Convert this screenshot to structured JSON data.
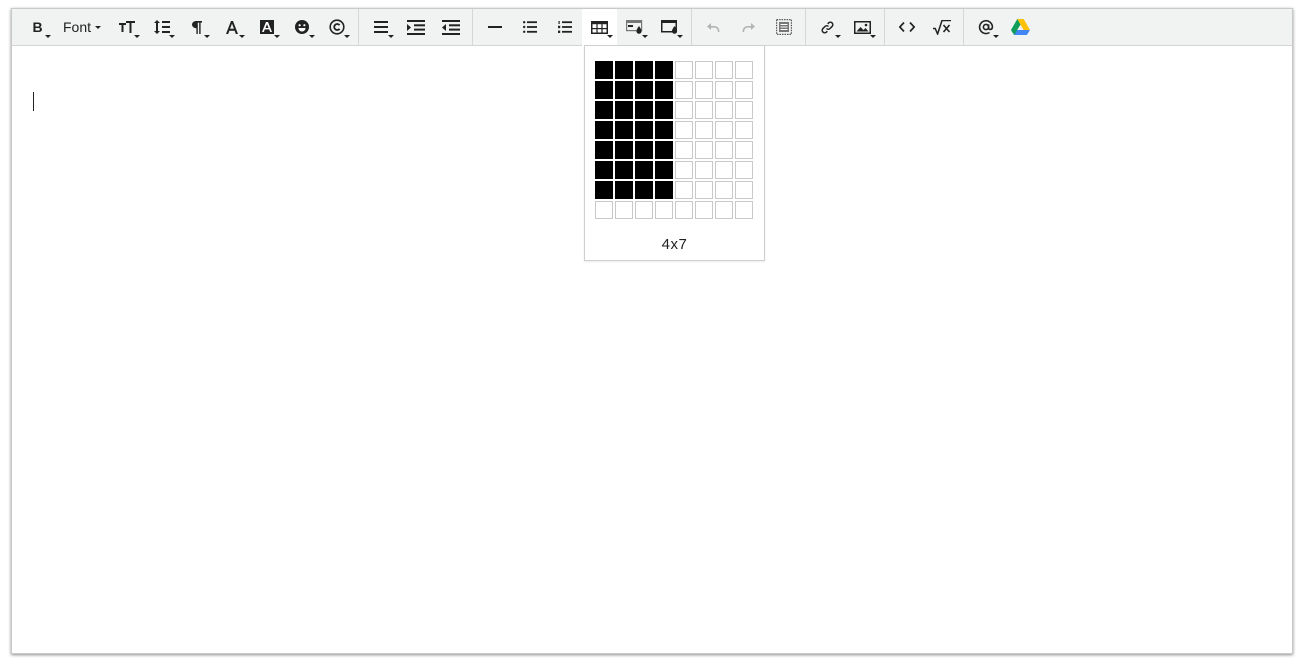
{
  "toolbar": {
    "bold_label": "B",
    "font_label": "Font",
    "buttons": [
      {
        "icon": "bold-icon"
      },
      {
        "icon": "font-menu"
      },
      {
        "icon": "font-size-icon"
      },
      {
        "icon": "line-height-icon"
      },
      {
        "icon": "paragraph-format-icon"
      },
      {
        "icon": "text-color-icon"
      },
      {
        "icon": "background-color-icon"
      },
      {
        "icon": "emoticons-icon"
      },
      {
        "icon": "special-characters-icon"
      },
      {
        "icon": "align-icon"
      },
      {
        "icon": "indent-icon"
      },
      {
        "icon": "outdent-icon"
      },
      {
        "icon": "horizontal-line-icon"
      },
      {
        "icon": "unordered-list-icon"
      },
      {
        "icon": "ordered-list-icon"
      },
      {
        "icon": "insert-table-icon"
      },
      {
        "icon": "table-style-icon"
      },
      {
        "icon": "cell-style-icon"
      },
      {
        "icon": "undo-icon"
      },
      {
        "icon": "redo-icon"
      },
      {
        "icon": "select-all-icon"
      },
      {
        "icon": "link-icon"
      },
      {
        "icon": "image-icon"
      },
      {
        "icon": "code-view-icon"
      },
      {
        "icon": "math-icon"
      },
      {
        "icon": "mention-icon"
      },
      {
        "icon": "google-drive-icon"
      }
    ]
  },
  "table_picker": {
    "columns": 8,
    "rows": 8,
    "selected_columns": 4,
    "selected_rows": 7,
    "size_label": "4x7"
  },
  "colors": {
    "toolbar_bg": "#f1f3f3",
    "selected_cell": "#000000",
    "cell_border": "#c9c9c9",
    "disabled_icon": "#b4b4b4"
  }
}
